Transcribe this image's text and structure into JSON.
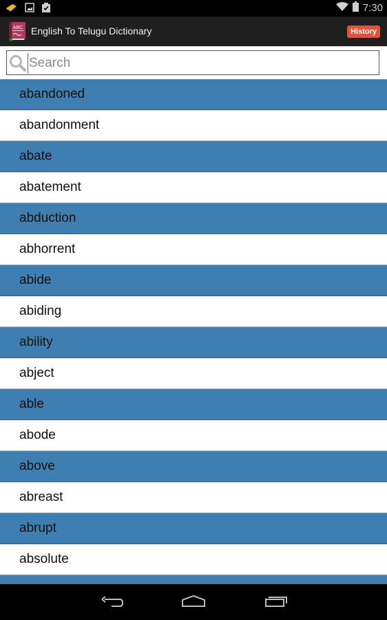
{
  "status_bar": {
    "left_icons": [
      "sync-pencil-icon",
      "image-icon",
      "clipboard-check-icon"
    ],
    "right_icons": [
      "wifi-icon",
      "battery-icon"
    ],
    "time": "7:30"
  },
  "action_bar": {
    "app_icon": "abc-dictionary-book-icon",
    "title": "English To Telugu Dictionary",
    "history_label": "History",
    "history_color": "#e0523a"
  },
  "search": {
    "placeholder": "Search",
    "value": "",
    "icon": "search-icon"
  },
  "colors": {
    "row_blue": "#3e7eb0",
    "row_white": "#ffffff",
    "action_bar_bg": "#1f1f1f"
  },
  "words": [
    "abandoned",
    "abandonment",
    "abate",
    "abatement",
    "abduction",
    "abhorrent",
    "abide",
    "abiding",
    "ability",
    "abject",
    "able",
    "abode",
    "above",
    "abreast",
    "abrupt",
    "absolute",
    ""
  ],
  "nav_bar": {
    "buttons": [
      "back-icon",
      "home-icon",
      "recent-apps-icon"
    ]
  }
}
